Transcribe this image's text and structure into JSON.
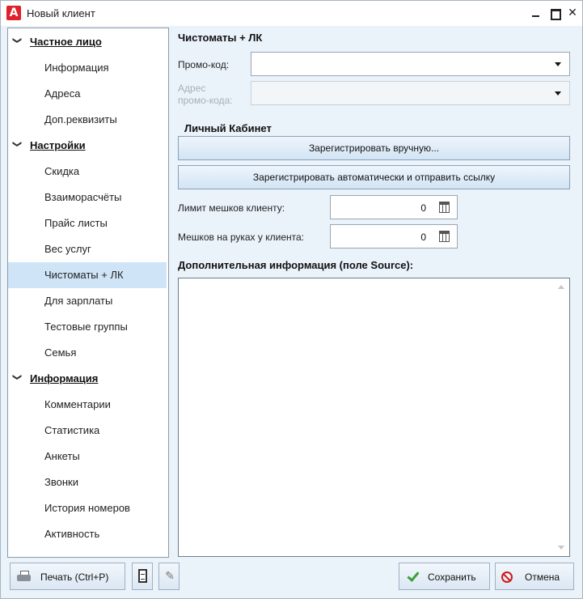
{
  "window": {
    "title": "Новый клиент",
    "logo_letter": "A"
  },
  "sidebar": {
    "groups": [
      {
        "label": "Частное лицо",
        "items": [
          {
            "label": "Информация"
          },
          {
            "label": "Адреса"
          },
          {
            "label": "Доп.реквизиты"
          }
        ]
      },
      {
        "label": "Настройки",
        "items": [
          {
            "label": "Скидка"
          },
          {
            "label": "Взаиморасчёты"
          },
          {
            "label": "Прайс листы"
          },
          {
            "label": "Вес услуг"
          },
          {
            "label": "Чистоматы + ЛК",
            "selected": true
          },
          {
            "label": "Для зарплаты"
          },
          {
            "label": "Тестовые группы"
          },
          {
            "label": "Семья"
          }
        ]
      },
      {
        "label": "Информация",
        "items": [
          {
            "label": "Комментарии"
          },
          {
            "label": "Статистика"
          },
          {
            "label": "Анкеты"
          },
          {
            "label": "Звонки"
          },
          {
            "label": "История номеров"
          },
          {
            "label": "Активность"
          }
        ]
      }
    ]
  },
  "main": {
    "title": "Чистоматы + ЛК",
    "promo_code": {
      "label": "Промо-код:",
      "value": ""
    },
    "promo_address": {
      "label_line1": "Адрес",
      "label_line2": "промо-кода:",
      "value": ""
    },
    "cabinet": {
      "title": "Личный Кабинет",
      "register_manual_label": "Зарегистрировать вручную...",
      "register_auto_label": "Зарегистрировать автоматически и отправить ссылку"
    },
    "bag_limit": {
      "label": "Лимит мешков клиенту:",
      "value": "0"
    },
    "bags_on_hand": {
      "label": "Мешков на руках у клиента:",
      "value": "0"
    },
    "extra_info": {
      "label": "Дополнительная информация (поле Source):",
      "value": ""
    }
  },
  "footer": {
    "print_label": "Печать (Ctrl+P)",
    "save_label": "Сохранить",
    "cancel_label": "Отмена"
  },
  "colors": {
    "accent_selected": "#cfe4f7",
    "background": "#eaf2fa",
    "logo": "#e0202a"
  }
}
